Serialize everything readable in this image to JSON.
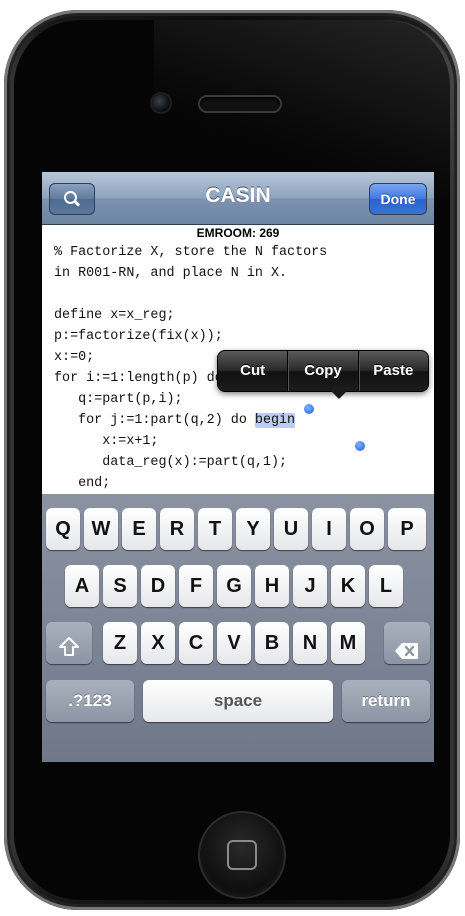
{
  "navbar": {
    "title": "CASIN",
    "search_icon": "search-icon",
    "done_label": "Done"
  },
  "document": {
    "heading": "EMROOM: 269",
    "lines": [
      "% Factorize X, store the N factors",
      "in R001-RN, and place N in X.",
      "",
      "define x=x_reg;",
      "p:=factorize(fix(x));",
      "x:=0;",
      "for i:=1:length(p) do",
      "   q:=part(p,i);",
      "   for j:=1:part(q,2) do ",
      "      x:=x+1;",
      "      data_reg(x):=part(q,1);",
      "   end;"
    ],
    "selected_word": "begin"
  },
  "edit_menu": {
    "items": [
      "Cut",
      "Copy",
      "Paste"
    ]
  },
  "keyboard": {
    "row1": [
      "Q",
      "W",
      "E",
      "R",
      "T",
      "Y",
      "U",
      "I",
      "O",
      "P"
    ],
    "row2": [
      "A",
      "S",
      "D",
      "F",
      "G",
      "H",
      "J",
      "K",
      "L"
    ],
    "row3": [
      "Z",
      "X",
      "C",
      "V",
      "B",
      "N",
      "M"
    ],
    "shift_icon": "shift-icon",
    "delete_icon": "delete-icon",
    "numbers_label": ".?123",
    "space_label": "space",
    "return_label": "return"
  },
  "colors": {
    "selection": "#b8cdf0",
    "done_button": "#3e78e0",
    "navbar": "#7d93b0"
  }
}
